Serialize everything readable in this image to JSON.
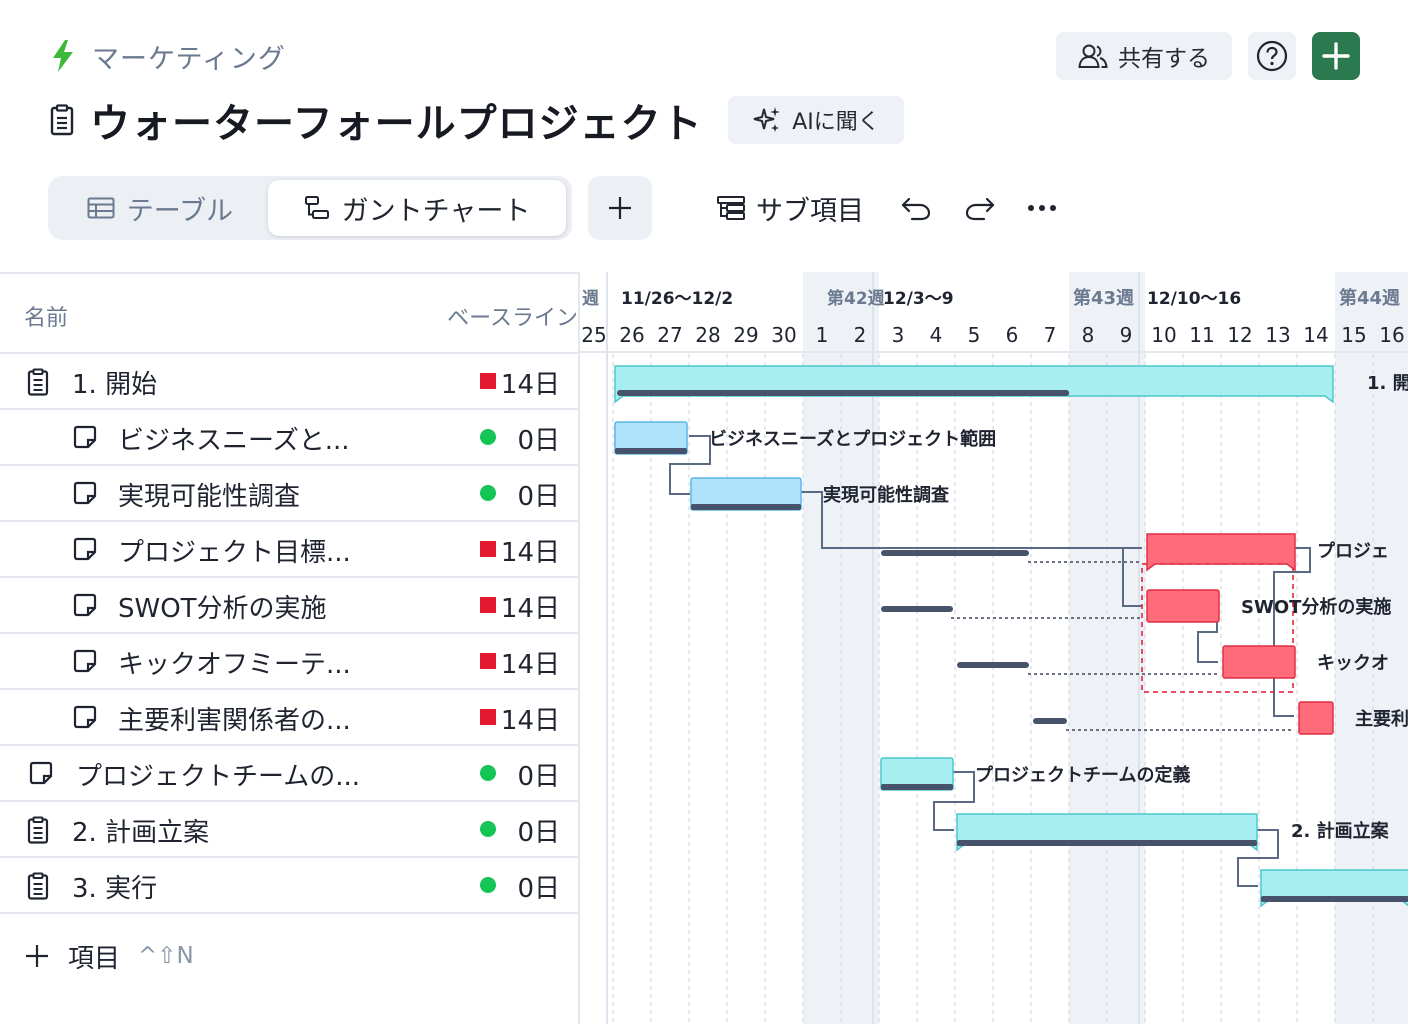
{
  "header": {
    "breadcrumb": "マーケティング",
    "title": "ウォーターフォールプロジェクト",
    "ai_button": "AIに聞く",
    "share_button": "共有する"
  },
  "view": {
    "tabs": [
      {
        "label": "テーブル",
        "icon": "table-icon",
        "active": false
      },
      {
        "label": "ガントチャート",
        "icon": "gantt-icon",
        "active": true
      }
    ],
    "sub_items": "サブ項目"
  },
  "table": {
    "columns": {
      "name": "名前",
      "baseline": "ベースライン"
    },
    "rows": [
      {
        "label": "1. 開始",
        "baseline": "14日",
        "status": "red",
        "icon": "clipboard-icon",
        "indent": 0
      },
      {
        "label": "ビジネスニーズと...",
        "baseline": "0日",
        "status": "green",
        "icon": "note-icon",
        "indent": 1
      },
      {
        "label": "実現可能性調査",
        "baseline": "0日",
        "status": "green",
        "icon": "note-icon",
        "indent": 1
      },
      {
        "label": "プロジェクト目標...",
        "baseline": "14日",
        "status": "red",
        "icon": "note-icon",
        "indent": 1
      },
      {
        "label": "SWOT分析の実施",
        "baseline": "14日",
        "status": "red",
        "icon": "note-icon",
        "indent": 1
      },
      {
        "label": "キックオフミーテ...",
        "baseline": "14日",
        "status": "red",
        "icon": "note-icon",
        "indent": 1
      },
      {
        "label": "主要利害関係者の...",
        "baseline": "14日",
        "status": "red",
        "icon": "note-icon",
        "indent": 1
      },
      {
        "label": "プロジェクトチームの...",
        "baseline": "0日",
        "status": "green",
        "icon": "note-icon",
        "indent": 0
      },
      {
        "label": "2. 計画立案",
        "baseline": "0日",
        "status": "green",
        "icon": "clipboard-icon",
        "indent": 0
      },
      {
        "label": "3. 実行",
        "baseline": "0日",
        "status": "green",
        "icon": "clipboard-icon",
        "indent": 0
      }
    ],
    "add_item": {
      "label": "項目",
      "shortcut": "^⇧N"
    }
  },
  "timeline": {
    "weeks": [
      {
        "label": "第42週",
        "first_day_index": 6
      },
      {
        "label": "12/3〜9",
        "first_day_index": 8
      },
      {
        "label": "第43週",
        "first_day_index": 13
      },
      {
        "label": "12/10〜16",
        "first_day_index": 15
      },
      {
        "label": "第44週",
        "first_day_index": 20
      },
      {
        "label": "週",
        "first_day_index": -1
      },
      {
        "label": "11/26〜12/2",
        "first_day_index": 1
      }
    ],
    "days": [
      "25",
      "26",
      "27",
      "28",
      "29",
      "30",
      "1",
      "2",
      "3",
      "4",
      "5",
      "6",
      "7",
      "8",
      "9",
      "10",
      "11",
      "12",
      "13",
      "14",
      "15",
      "16"
    ],
    "weekend_day_indices": [
      6,
      7,
      13,
      14,
      20,
      21
    ],
    "tasks": [
      {
        "label": "1. 開始",
        "row": 0,
        "start": 1,
        "end": 20,
        "type": "summary",
        "progress_end": 12.9
      },
      {
        "label": "ビジネスニーズとプロジェクト範囲",
        "row": 1,
        "start": 1,
        "end": 3,
        "type": "task-blue"
      },
      {
        "label": "実現可能性調査",
        "row": 2,
        "start": 3,
        "end": 6,
        "type": "task-blue"
      },
      {
        "label": "プロジェ",
        "row": 3,
        "start": 15,
        "end": 19,
        "type": "summary-red",
        "baseline_start": 8,
        "baseline_end": 12
      },
      {
        "label": "SWOT分析の実施",
        "row": 4,
        "start": 15,
        "end": 17,
        "type": "task-red",
        "baseline_start": 8,
        "baseline_end": 10
      },
      {
        "label": "キックオ",
        "row": 5,
        "start": 17,
        "end": 19,
        "type": "task-red",
        "baseline_start": 10,
        "baseline_end": 12
      },
      {
        "label": "主要利",
        "row": 6,
        "start": 19,
        "end": 20,
        "type": "task-red",
        "baseline_start": 12,
        "baseline_end": 13
      },
      {
        "label": "プロジェクトチームの定義",
        "row": 7,
        "start": 8,
        "end": 10,
        "type": "task-cyan"
      },
      {
        "label": "2. 計画立案",
        "row": 8,
        "start": 10,
        "end": 18,
        "type": "summary"
      },
      {
        "label": "",
        "row": 9,
        "start": 18,
        "end": 22,
        "type": "summary"
      }
    ]
  },
  "colors": {
    "accent_green": "#2b7a4f",
    "lightning": "#3cb83c",
    "red": "#e3192f",
    "green_dot": "#14c455",
    "bar_cyan": "#a6eef0",
    "bar_blue": "#aee3fb",
    "bar_red": "#ff6b7a",
    "dark": "#46536b"
  }
}
